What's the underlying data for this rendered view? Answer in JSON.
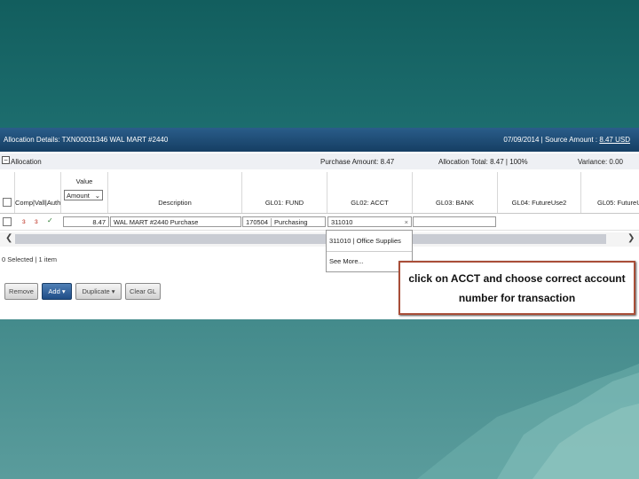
{
  "window": {
    "title": "Allocation Details: TXN00031346 WAL MART #2440",
    "date_source_prefix": "07/09/2014 | Source Amount : ",
    "source_amount_link": "8.47 USD"
  },
  "allocation": {
    "section_label": "Allocation",
    "purchase_amount": "Purchase Amount: 8.47",
    "allocation_total": "Allocation Total: 8.47 | 100%",
    "variance": "Variance: 0.00"
  },
  "columns": {
    "comp_vall_auth": "Comp|Vall|Auth",
    "value": "Value",
    "value_select": "Amount",
    "description": "Description",
    "gl01": "GL01: FUND",
    "gl02": "GL02: ACCT",
    "gl03": "GL03: BANK",
    "gl04": "GL04: FutureUse2",
    "gl05": "GL05: FutureU"
  },
  "row": {
    "value": "8.47",
    "description": "WAL MART #2440 Purchase",
    "gl01_code": "170504",
    "gl01_name": "Purchasing",
    "gl02_input": "311010",
    "clear": "×"
  },
  "dropdown": {
    "option1": "311010 | Office Supplies",
    "option2": "See More..."
  },
  "status": "0 Selected | 1 item",
  "buttons": {
    "remove": "Remove",
    "add": "Add ▾",
    "duplicate": "Duplicate ▾",
    "clear_gl": "Clear GL"
  },
  "callout": {
    "line1": "click on ACCT and choose correct account",
    "line2": "number for transaction"
  },
  "colors": {
    "background_top": "#125e5e",
    "titlebar": "#1f4f7a",
    "callout_border": "#a94e38"
  }
}
